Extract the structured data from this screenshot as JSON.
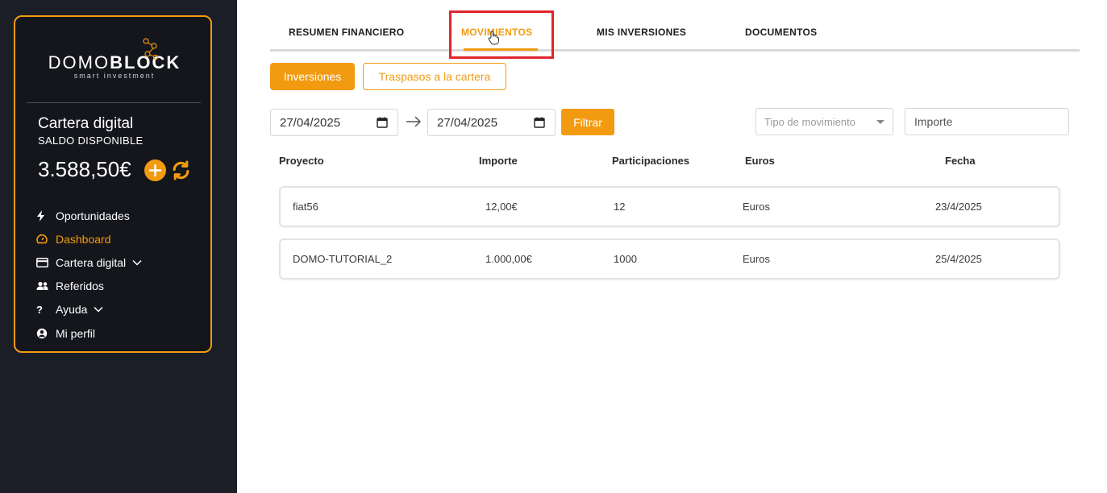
{
  "brand": {
    "name_light": "DOMO",
    "name_bold": "BLOCK",
    "tagline": "smart investment"
  },
  "wallet": {
    "title": "Cartera digital",
    "subtitle": "SALDO DISPONIBLE",
    "balance": "3.588,50€"
  },
  "nav": [
    {
      "label": "Oportunidades",
      "icon": "bolt-icon",
      "active": false
    },
    {
      "label": "Dashboard",
      "icon": "dashboard-icon",
      "active": true
    },
    {
      "label": "Cartera digital",
      "icon": "card-icon",
      "active": false,
      "expandable": true
    },
    {
      "label": "Referidos",
      "icon": "users-icon",
      "active": false
    },
    {
      "label": "Ayuda",
      "icon": "question-icon",
      "active": false,
      "expandable": true
    },
    {
      "label": "Mi perfil",
      "icon": "user-circle-icon",
      "active": false
    }
  ],
  "tabs": [
    "RESUMEN FINANCIERO",
    "MOVIMIENTOS",
    "MIS INVERSIONES",
    "DOCUMENTOS"
  ],
  "active_tab": "MOVIMIENTOS",
  "subtabs": {
    "primary": "Inversiones",
    "secondary": "Traspasos a la cartera"
  },
  "filters": {
    "date_from": "27/04/2025",
    "date_to": "27/04/2025",
    "filter_button": "Filtrar",
    "type_placeholder": "Tipo de movimiento",
    "amount_placeholder": "Importe"
  },
  "table": {
    "headers": [
      "Proyecto",
      "Importe",
      "Participaciones",
      "Euros",
      "Fecha"
    ],
    "rows": [
      [
        "fiat56",
        "12,00€",
        "12",
        "Euros",
        "23/4/2025"
      ],
      [
        "DOMO-TUTORIAL_2",
        "1.000,00€",
        "1000",
        "Euros",
        "25/4/2025"
      ]
    ]
  },
  "colors": {
    "accent": "#f29b10",
    "sidebar_bg": "#1b1e26",
    "highlight": "#e0252b"
  }
}
